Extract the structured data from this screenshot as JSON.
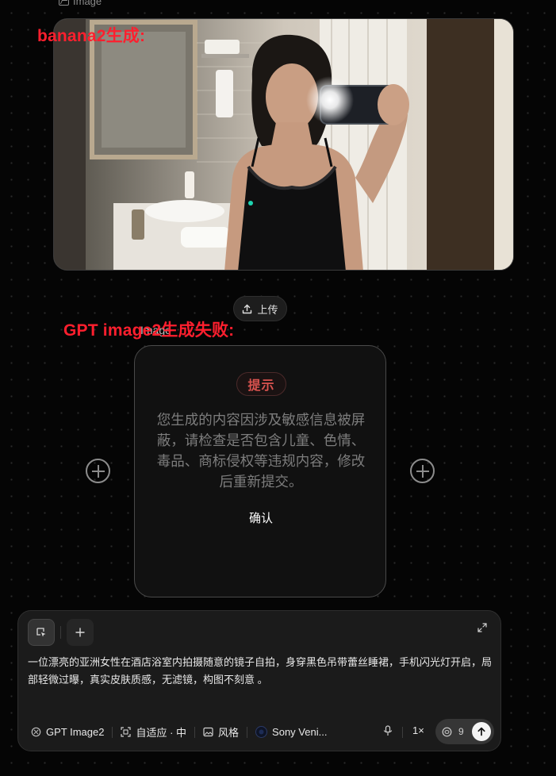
{
  "node_label": "Image",
  "annotation_top": "banana2生成:",
  "annotation_middle": "GPT image2生成失败:",
  "upload_label": "上传",
  "under_label": "Image",
  "modal": {
    "badge": "提示",
    "message": "您生成的内容因涉及敏感信息被屏蔽，请检查是否包含儿童、色情、毒品、商标侵权等违规内容，修改后重新提交。",
    "confirm_label": "确认"
  },
  "composer": {
    "prompt": "一位漂亮的亚洲女性在酒店浴室内拍摄随意的镜子自拍，身穿黑色吊带蕾丝睡裙，手机闪光灯开启，局部轻微过曝，真实皮肤质感，无滤镜，构图不刻意 。",
    "model": "GPT Image2",
    "size": "自适应 · 中",
    "style": "风格",
    "camera": "Sony Veni...",
    "multiplier": "1×",
    "credits": "9"
  },
  "colors": {
    "annotation": "#ff1f2e",
    "badge_text": "#d9534f",
    "background": "#050505"
  },
  "icons": [
    "image-icon",
    "upload-icon",
    "add-node-icon",
    "select-icon",
    "plus-icon",
    "expand-icon",
    "model-icon",
    "aspect-icon",
    "style-icon",
    "camera-icon",
    "mic-icon",
    "credits-icon",
    "send-arrow-icon"
  ]
}
